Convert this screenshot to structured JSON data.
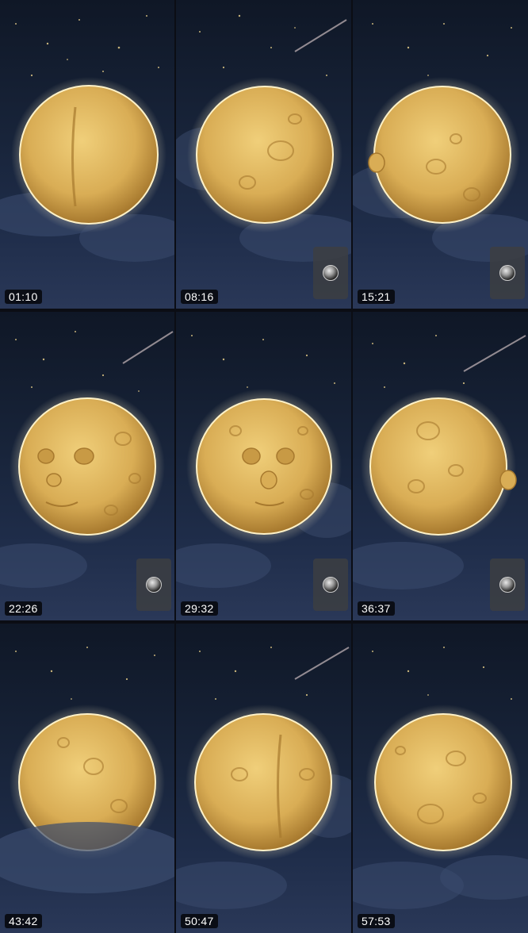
{
  "frames": [
    {
      "timestamp": "01:10",
      "camera_button": false,
      "moon_view": "back",
      "comet": false
    },
    {
      "timestamp": "08:16",
      "camera_button": true,
      "moon_view": "back-quarter",
      "comet": true
    },
    {
      "timestamp": "15:21",
      "camera_button": true,
      "moon_view": "profile-left",
      "comet": false
    },
    {
      "timestamp": "22:26",
      "camera_button": true,
      "moon_view": "face-three-quarter",
      "comet": true
    },
    {
      "timestamp": "29:32",
      "camera_button": true,
      "moon_view": "face-front",
      "comet": false
    },
    {
      "timestamp": "36:37",
      "camera_button": true,
      "moon_view": "profile-right",
      "comet": true
    },
    {
      "timestamp": "43:42",
      "camera_button": false,
      "moon_view": "back-quarter",
      "comet": false
    },
    {
      "timestamp": "50:47",
      "camera_button": false,
      "moon_view": "back",
      "comet": true
    },
    {
      "timestamp": "57:53",
      "camera_button": false,
      "moon_view": "profile-left",
      "comet": false
    }
  ],
  "colors": {
    "moon_fill": "#d9ad55",
    "moon_shade": "#a7792e",
    "moon_highlight": "#f0cf7a",
    "glow": "#fff2c8",
    "sky_top": "#0f1726",
    "sky_bottom": "#2a3858",
    "cloud": "#3b4b6e",
    "star": "#f4d98e"
  },
  "icons": {
    "camera_button": "camera-lens-icon"
  }
}
